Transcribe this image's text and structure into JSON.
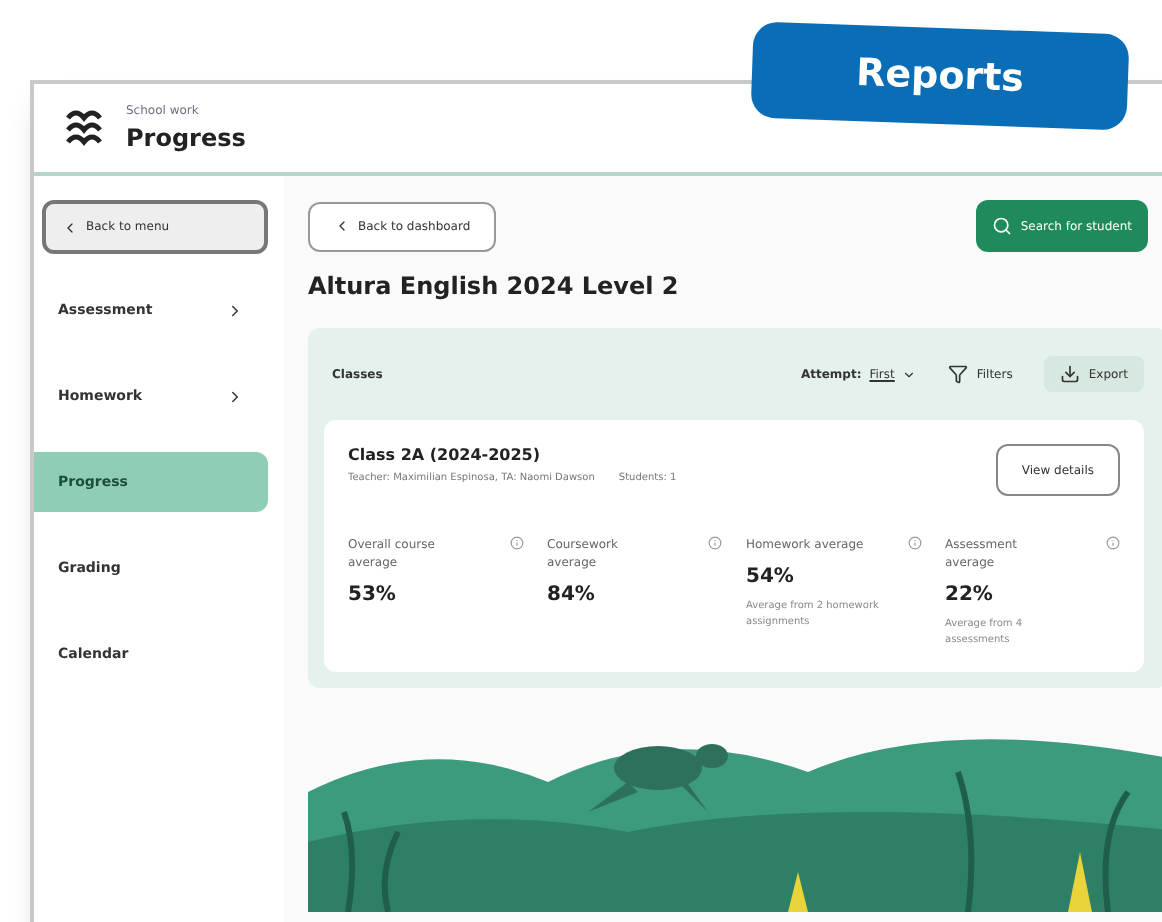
{
  "badge": {
    "label": "Reports"
  },
  "header": {
    "overline": "School work",
    "title": "Progress"
  },
  "sidebar": {
    "back": "Back to menu",
    "items": [
      {
        "label": "Assessment",
        "has_children": true,
        "selected": false
      },
      {
        "label": "Homework",
        "has_children": true,
        "selected": false
      },
      {
        "label": "Progress",
        "has_children": false,
        "selected": true
      },
      {
        "label": "Grading",
        "has_children": false,
        "selected": false
      },
      {
        "label": "Calendar",
        "has_children": false,
        "selected": false
      }
    ]
  },
  "main": {
    "back": "Back to dashboard",
    "search_button": "Search for student",
    "course_title": "Altura English 2024 Level 2",
    "classes": {
      "heading": "Classes",
      "attempt_label": "Attempt:",
      "attempt_value": "First",
      "filters": "Filters",
      "export": "Export",
      "card": {
        "title": "Class 2A (2024-2025)",
        "teacher": "Teacher: Maximilian Espinosa, TA: Naomi Dawson",
        "students": "Students: 1",
        "view_button": "View details",
        "metrics": [
          {
            "label": "Overall course average",
            "value": "53%"
          },
          {
            "label": "Coursework average",
            "value": "84%"
          },
          {
            "label": "Homework average",
            "value": "54%",
            "note": "Average from 2 homework assignments"
          },
          {
            "label": "Assessment average",
            "value": "22%",
            "note": "Average from 4 assessments"
          }
        ]
      }
    }
  }
}
